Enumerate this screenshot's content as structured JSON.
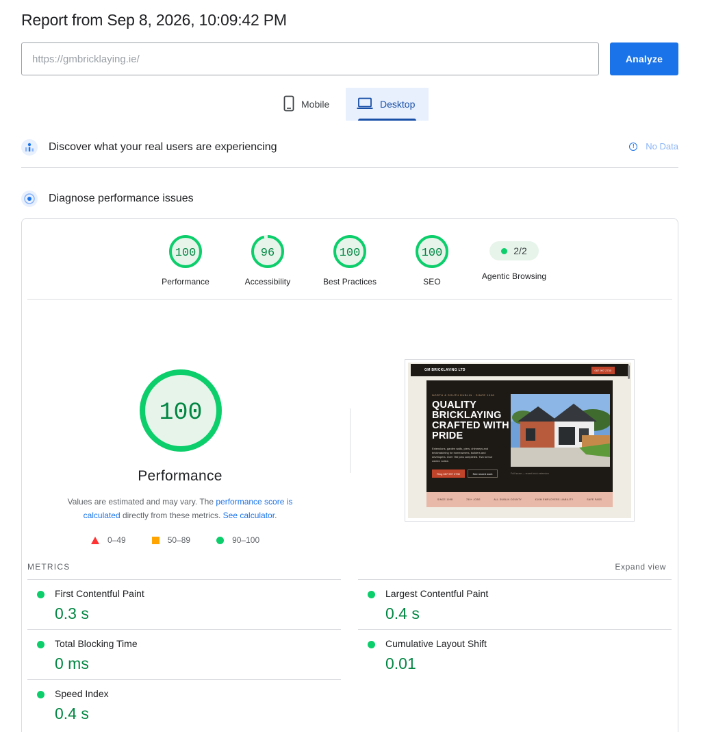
{
  "report": {
    "title": "Report from Sep 8, 2026, 10:09:42 PM"
  },
  "search": {
    "placeholder": "https://gmbricklaying.ie/",
    "value": "",
    "analyze_label": "Analyze"
  },
  "tabs": [
    {
      "label": "Mobile",
      "icon": "phone-icon",
      "selected": false
    },
    {
      "label": "Desktop",
      "icon": "laptop-icon",
      "selected": true
    }
  ],
  "field_data": {
    "title": "Discover what your real users are experiencing",
    "status": "No Data"
  },
  "diagnose": {
    "title": "Diagnose performance issues"
  },
  "scores": [
    {
      "label": "Performance",
      "value": "100",
      "fraction": 1.0
    },
    {
      "label": "Accessibility",
      "value": "96",
      "fraction": 0.96
    },
    {
      "label": "Best Practices",
      "value": "100",
      "fraction": 1.0
    },
    {
      "label": "SEO",
      "value": "100",
      "fraction": 1.0
    }
  ],
  "agentic": {
    "label": "Agentic Browsing",
    "value": "2/2"
  },
  "performance": {
    "score": "100",
    "title": "Performance",
    "desc_1": "Values are estimated and may vary. The ",
    "link_1": "performance score is calculated",
    "desc_2": " directly from these metrics. ",
    "link_2": "See calculator",
    "desc_3": "."
  },
  "legend": [
    {
      "shape": "triangle",
      "label": "0–49",
      "color": "#ff3333"
    },
    {
      "shape": "square",
      "label": "50–89",
      "color": "#ffa400"
    },
    {
      "shape": "circle",
      "label": "90–100",
      "color": "#0cce6b"
    }
  ],
  "screenshot": {
    "brand": "GM BRICKLAYING LTD",
    "cta": "087 997 2730",
    "eyebrow": "NORTH & SOUTH DUBLIN · SINCE 1998",
    "headline": "QUALITY BRICKLAYING CRAFTED WITH PRIDE",
    "body": "Extensions, garden walls, piers, chimneys and brickmatching for homeowners, builders and developers. Over 750 jobs completed. Two to four weeks' notice.",
    "btn_primary": "Ring 087 997 2730",
    "btn_secondary": "See recent work",
    "caption": "Full house — recent brick extension",
    "strip": [
      "SINCE 1998",
      "750+ JOBS",
      "ALL DUBLIN COUNTY",
      "£10M EMPLOYERS LIABILITY",
      "SAFE PASS"
    ]
  },
  "metrics": {
    "label": "METRICS",
    "expand": "Expand view",
    "items": [
      {
        "name": "First Contentful Paint",
        "value": "0.3 s"
      },
      {
        "name": "Largest Contentful Paint",
        "value": "0.4 s"
      },
      {
        "name": "Total Blocking Time",
        "value": "0 ms"
      },
      {
        "name": "Cumulative Layout Shift",
        "value": "0.01"
      },
      {
        "name": "Speed Index",
        "value": "0.4 s"
      }
    ]
  },
  "colors": {
    "pass": "#0cce6b",
    "pass_text": "#018642",
    "pass_bg": "#e6f4ea",
    "accent": "#1a73e8",
    "tab_active": "#174ea6"
  }
}
